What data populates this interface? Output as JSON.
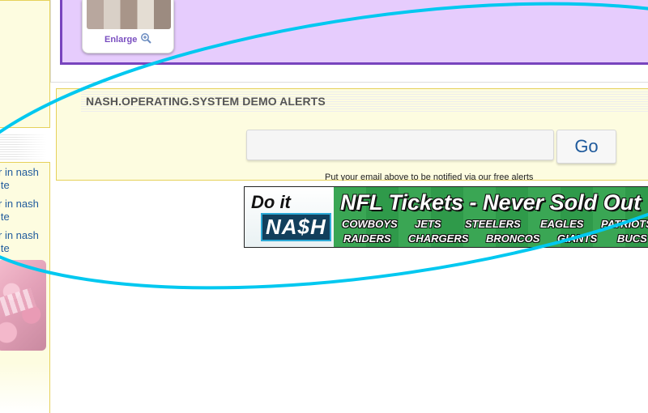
{
  "sidebar": {
    "items": [
      {
        "line1": "r in nash",
        "line2": "ite"
      },
      {
        "line1": "r in nash",
        "line2": "ite"
      },
      {
        "line1": "r in nash",
        "line2": "ite"
      }
    ]
  },
  "product": {
    "enlarge_label": "Enlarge",
    "zoom_icon": "magnifier-plus-icon"
  },
  "alerts": {
    "title": "NASH.OPERATING.SYSTEM DEMO ALERTS",
    "email_value": "",
    "email_placeholder": "",
    "go_label": "Go",
    "note": "Put your email above to be notified via our free alerts"
  },
  "banner": {
    "logo_do": "Do it",
    "logo_nash": "NA$H",
    "headline": "NFL Tickets - Never Sold Out",
    "teams": [
      "COWBOYS",
      "JETS",
      "STEELERS",
      "EAGLES",
      "PATRIOTS",
      "RAIDERS",
      "CHARGERS",
      "BRONCOS",
      "GIANTS",
      "BUCS"
    ]
  },
  "colors": {
    "panel_purple": "#e6ccfd",
    "panel_border": "#7844be",
    "alert_bg": "#fdfce0",
    "alert_border": "#e6d15a",
    "link_blue": "#1f5a9c",
    "annotation_cyan": "#00c8f0"
  }
}
